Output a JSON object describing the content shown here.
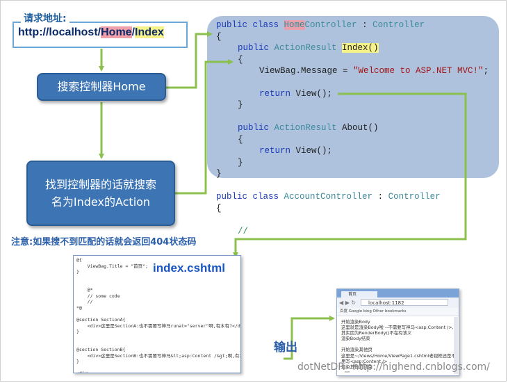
{
  "url_box": {
    "title": "请求地址:",
    "prefix": "http://localhost/",
    "controller": "Home",
    "slash": "/",
    "action": "Index"
  },
  "flow": {
    "step1": "搜索控制器Home",
    "step2_line1": "找到控制器的话就搜索",
    "step2_line2": "名为Index的Action"
  },
  "note": "注意:如果搜不到匹配的话就会返回404状态码",
  "code": {
    "l1_kw": "public class ",
    "l1_home": "Home",
    "l1_ctrl": "Controller",
    "l1_colon": " : ",
    "l1_base": "Controller",
    "brace_open": "{",
    "brace_close": "}",
    "l3_kw": "public ",
    "l3_type": "ActionResult ",
    "l3_method": "Index()",
    "l5_stmt": "ViewBag.Message = ",
    "l5_str": "\"Welcome to ASP.NET MVC!\"",
    "l5_end": ";",
    "return_kw": "return ",
    "return_rest": "View();",
    "l9_kw": "public ",
    "l9_type": "ActionResult ",
    "l9_method": "About()",
    "account_kw": "public class ",
    "account_name": "AccountController",
    "account_colon": " : ",
    "account_base": "Controller",
    "comment": "//"
  },
  "index_view": {
    "title": "index.cshtml",
    "code": "@{\n    ViewBag.Title = \"首页\";\n}\n\n\n    @*\n    // some code\n    //\n*@\n\n@section SectionA{\n    <div>这里是SectionA:也不需要写神马runat=\"server\"啊,有木有?</div>\n}\n\n\n@section SectionB{\n    <div>这里是SectionB:也不需要写神马&lt;asp:Content /&gt;啊,有木有?</div>\n}\n\n<div>\n    这里就是渲染Body啦.--不需要写神马&lt;asp:Content /&gt;,其实因为Render\n</div>"
  },
  "browser": {
    "tab": "首页",
    "nav": "◀ ▶ ↻",
    "url": "localhost:1182",
    "bookmarks": "百度   Google   bing          Other bookmarks",
    "body": "开始渲染Body\n这里就是渲染Body啦 --不需要写神马<asp:Content />,\n其实因为RenderBody()不在有该义\n渲染Body结束\n\n开始渲染其他页\n这里是~/Views/Home/ViewPage1.cshtml老视框还是不\n用写<asp:Content />\n渲染其他页结束"
  },
  "output_label": "输出",
  "watermark": "dotNetDR_ http://highend.cnblogs.com/",
  "colors": {
    "arrow": "#8cc04e",
    "box": "#3d74b4",
    "code_bg": "#aec2dd"
  }
}
